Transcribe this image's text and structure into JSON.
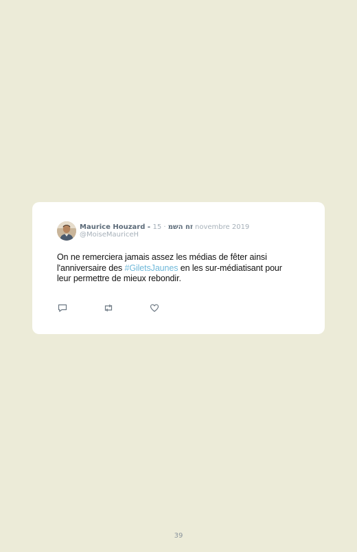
{
  "tweet": {
    "author_name": "Maurice Houzard - זח השמ",
    "separator": " · ",
    "date": "15 novembre 2019",
    "handle": "@MoiseMauriceH",
    "text_before": "On ne remerciera jamais assez les médias de fêter ainsi l'anniversaire des ",
    "hashtag": "#GiletsJaunes",
    "text_after": " en les sur-médiatisant pour leur permettre de mieux rebondir.",
    "avatar_icon": "person-avatar",
    "actions": [
      {
        "icon": "reply-icon"
      },
      {
        "icon": "retweet-icon"
      },
      {
        "icon": "like-icon"
      }
    ],
    "colors": {
      "hashtag": "#6fb8d9",
      "background": "#ecebd8",
      "card": "#ffffff"
    }
  },
  "page": {
    "number": "39"
  }
}
